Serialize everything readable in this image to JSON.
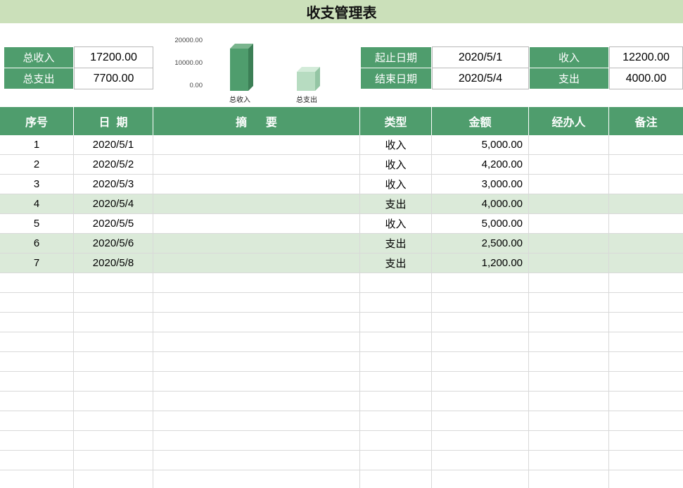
{
  "title": "收支管理表",
  "summary": {
    "total_income_label": "总收入",
    "total_income_value": "17200.00",
    "total_expense_label": "总支出",
    "total_expense_value": "7700.00",
    "start_date_label": "起止日期",
    "start_date_value": "2020/5/1",
    "end_date_label": "结束日期",
    "end_date_value": "2020/5/4",
    "income_label": "收入",
    "income_value": "12200.00",
    "expense_label": "支出",
    "expense_value": "4000.00"
  },
  "chart_data": {
    "type": "bar",
    "categories": [
      "总收入",
      "总支出"
    ],
    "values": [
      17200,
      7700
    ],
    "title": "",
    "xlabel": "",
    "ylabel": "",
    "ylim": [
      0,
      20000
    ],
    "ytick_labels": [
      "20000.00",
      "10000.00",
      "0.00"
    ],
    "grid": false,
    "legend_position": "none",
    "bar_style": "3d-column"
  },
  "table": {
    "headers": [
      "序号",
      "日  期",
      "摘      要",
      "类型",
      "金额",
      "经办人",
      "备注"
    ],
    "highlight_type": "支出",
    "rows": [
      {
        "seq": "1",
        "date": "2020/5/1",
        "summary": "",
        "type": "收入",
        "amount": "5,000.00",
        "handler": "",
        "note": ""
      },
      {
        "seq": "2",
        "date": "2020/5/2",
        "summary": "",
        "type": "收入",
        "amount": "4,200.00",
        "handler": "",
        "note": ""
      },
      {
        "seq": "3",
        "date": "2020/5/3",
        "summary": "",
        "type": "收入",
        "amount": "3,000.00",
        "handler": "",
        "note": ""
      },
      {
        "seq": "4",
        "date": "2020/5/4",
        "summary": "",
        "type": "支出",
        "amount": "4,000.00",
        "handler": "",
        "note": ""
      },
      {
        "seq": "5",
        "date": "2020/5/5",
        "summary": "",
        "type": "收入",
        "amount": "5,000.00",
        "handler": "",
        "note": ""
      },
      {
        "seq": "6",
        "date": "2020/5/6",
        "summary": "",
        "type": "支出",
        "amount": "2,500.00",
        "handler": "",
        "note": ""
      },
      {
        "seq": "7",
        "date": "2020/5/8",
        "summary": "",
        "type": "支出",
        "amount": "1,200.00",
        "handler": "",
        "note": ""
      }
    ],
    "empty_row_count": 11
  },
  "colors": {
    "accent_green": "#4f9d6d",
    "title_bg": "#cbe0ba",
    "highlight_row": "#dbead9",
    "grid_line": "#d9d9d9",
    "bar_income": "#4f9d6d",
    "bar_expense": "#b7dcc1"
  }
}
